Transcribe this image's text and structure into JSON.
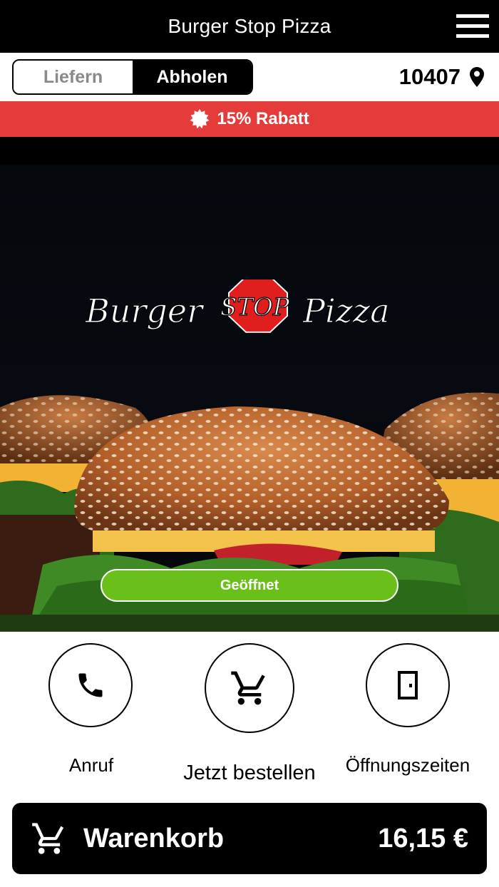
{
  "app": {
    "title": "Burger Stop Pizza"
  },
  "header": {
    "menu_icon": "hamburger-menu-icon"
  },
  "mode_toggle": {
    "options": [
      {
        "label": "Liefern",
        "selected": false
      },
      {
        "label": "Abholen",
        "selected": true
      }
    ]
  },
  "location": {
    "postcode": "10407",
    "icon": "map-pin-icon"
  },
  "promo": {
    "text": "15% Rabatt",
    "icon": "discount-badge-icon",
    "color": "#e63b3b"
  },
  "hero": {
    "logo_text": {
      "part1": "Burger",
      "part2": "STOP",
      "part3": "Pizza"
    },
    "status": "Geöffnet",
    "status_color": "#6abf1a"
  },
  "actions": [
    {
      "label": "Anruf",
      "icon": "phone-icon"
    },
    {
      "label": "Jetzt bestellen",
      "icon": "cart-icon"
    },
    {
      "label": "Öffnungszeiten",
      "icon": "door-icon"
    }
  ],
  "cart": {
    "label": "Warenkorb",
    "total": "16,15 €",
    "icon": "cart-icon"
  }
}
